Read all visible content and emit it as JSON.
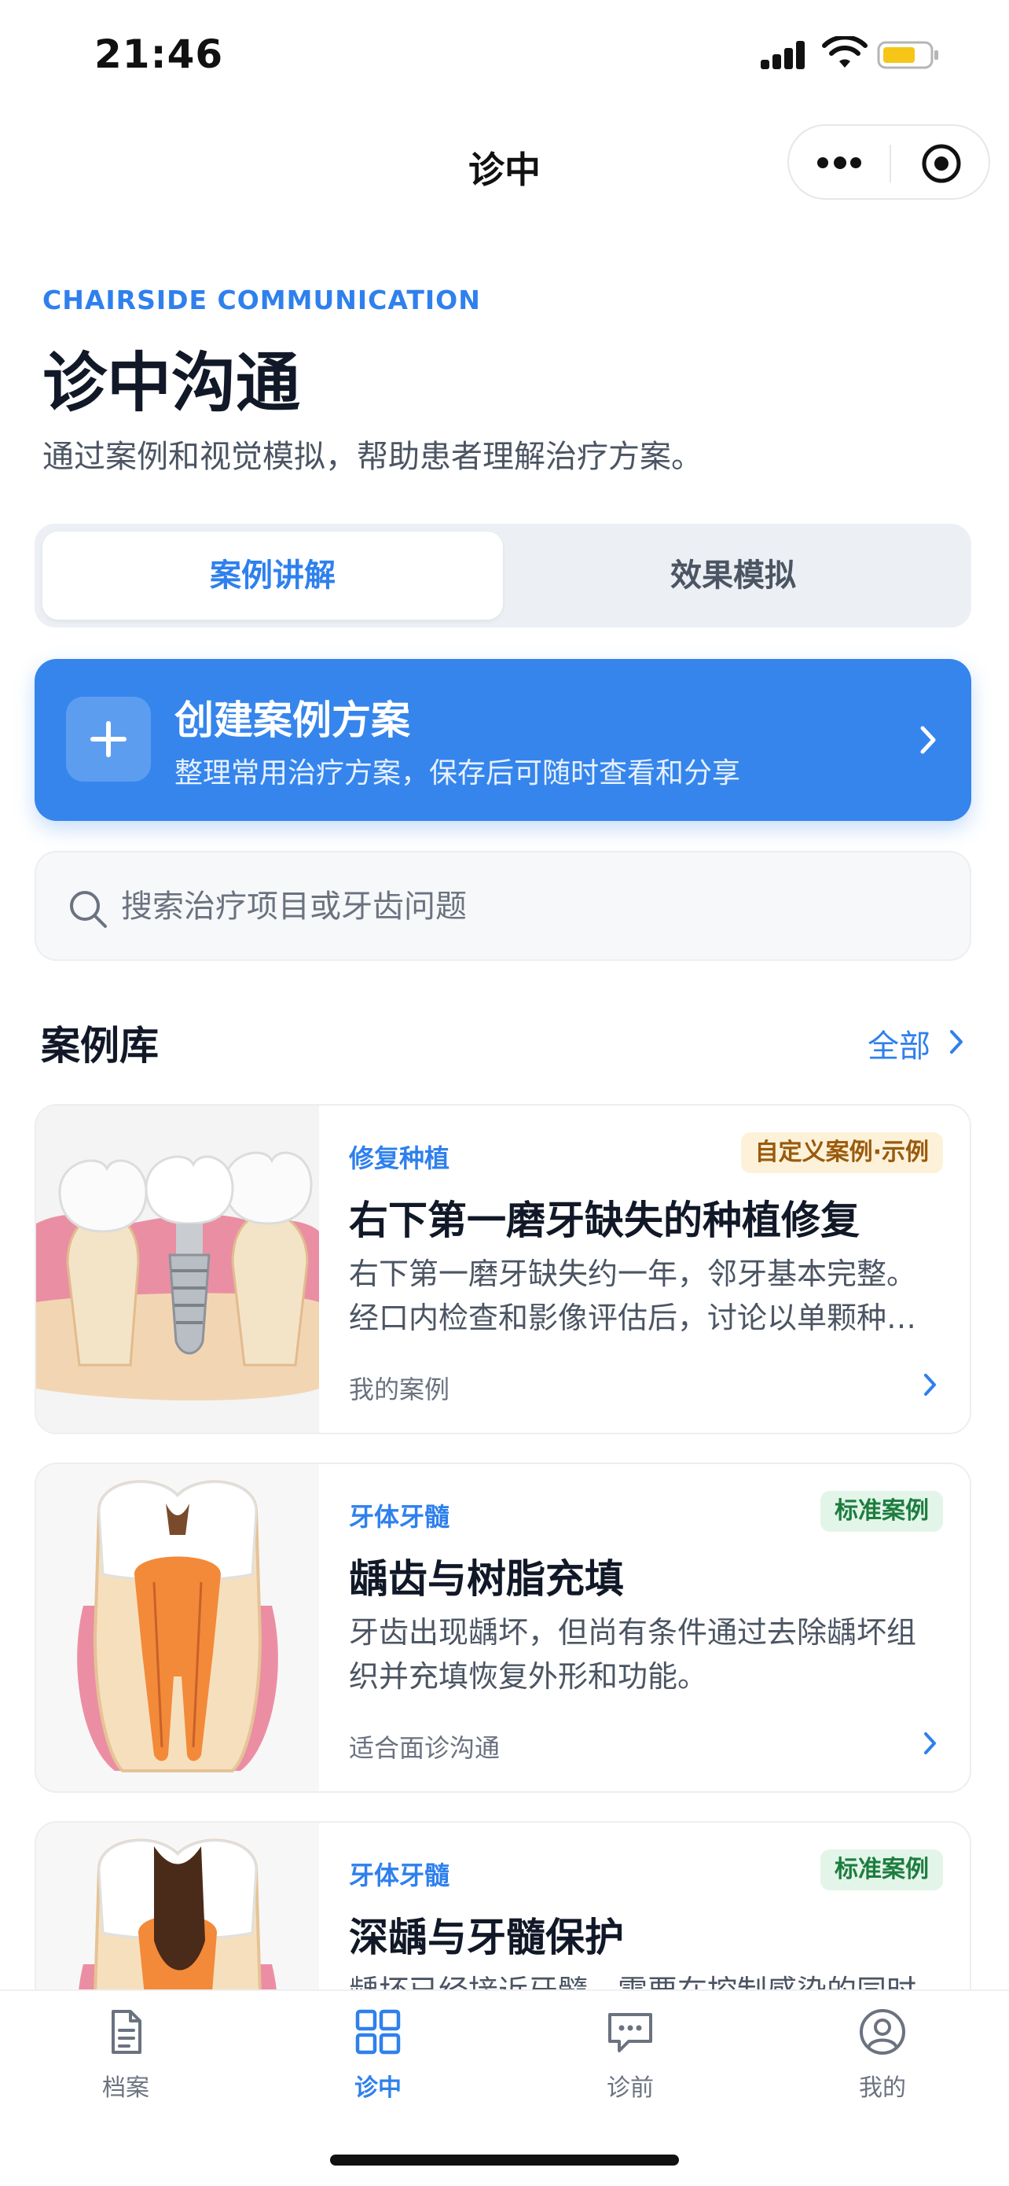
{
  "status_bar": {
    "time": "21:46",
    "battery_color": "#f5c518"
  },
  "nav": {
    "title": "诊中"
  },
  "header": {
    "eyebrow": "CHAIRSIDE COMMUNICATION",
    "title": "诊中沟通",
    "subtitle": "通过案例和视觉模拟，帮助患者理解治疗方案。"
  },
  "segmented": {
    "tabs": [
      "案例讲解",
      "效果模拟"
    ],
    "active_index": 0
  },
  "create_banner": {
    "title": "创建案例方案",
    "description": "整理常用治疗方案，保存后可随时查看和分享",
    "icon": "plus-icon"
  },
  "search": {
    "placeholder": "搜索治疗项目或牙齿问题",
    "value": ""
  },
  "section": {
    "title": "案例库",
    "view_all": "全部"
  },
  "cases": [
    {
      "category": "修复种植",
      "badge": "自定义案例·示例",
      "badge_type": "custom",
      "title": "右下第一磨牙缺失的种植修复",
      "description": "右下第一磨牙缺失约一年，邻牙基本完整。经口内检查和影像评估后，讨论以单颗种…",
      "meta": "我的案例",
      "image": "dental-implant-illustration"
    },
    {
      "category": "牙体牙髓",
      "badge": "标准案例",
      "badge_type": "standard",
      "title": "龋齿与树脂充填",
      "description": "牙齿出现龋坏，但尚有条件通过去除龋坏组织并充填恢复外形和功能。",
      "meta": "适合面诊沟通",
      "image": "tooth-cavity-cross-section"
    },
    {
      "category": "牙体牙髓",
      "badge": "标准案例",
      "badge_type": "standard",
      "title": "深龋与牙髓保护",
      "description": "龋坏已经接近牙髓，需要在控制感染的同时",
      "meta": "",
      "image": "deep-caries-cross-section"
    }
  ],
  "tabbar": {
    "items": [
      {
        "label": "档案",
        "icon": "document-icon"
      },
      {
        "label": "诊中",
        "icon": "grid-icon"
      },
      {
        "label": "诊前",
        "icon": "chat-icon"
      },
      {
        "label": "我的",
        "icon": "user-icon"
      }
    ],
    "active_index": 1
  },
  "colors": {
    "primary": "#2f80ed",
    "banner": "#3585ec",
    "text": "#111827",
    "muted": "#6b7280"
  }
}
